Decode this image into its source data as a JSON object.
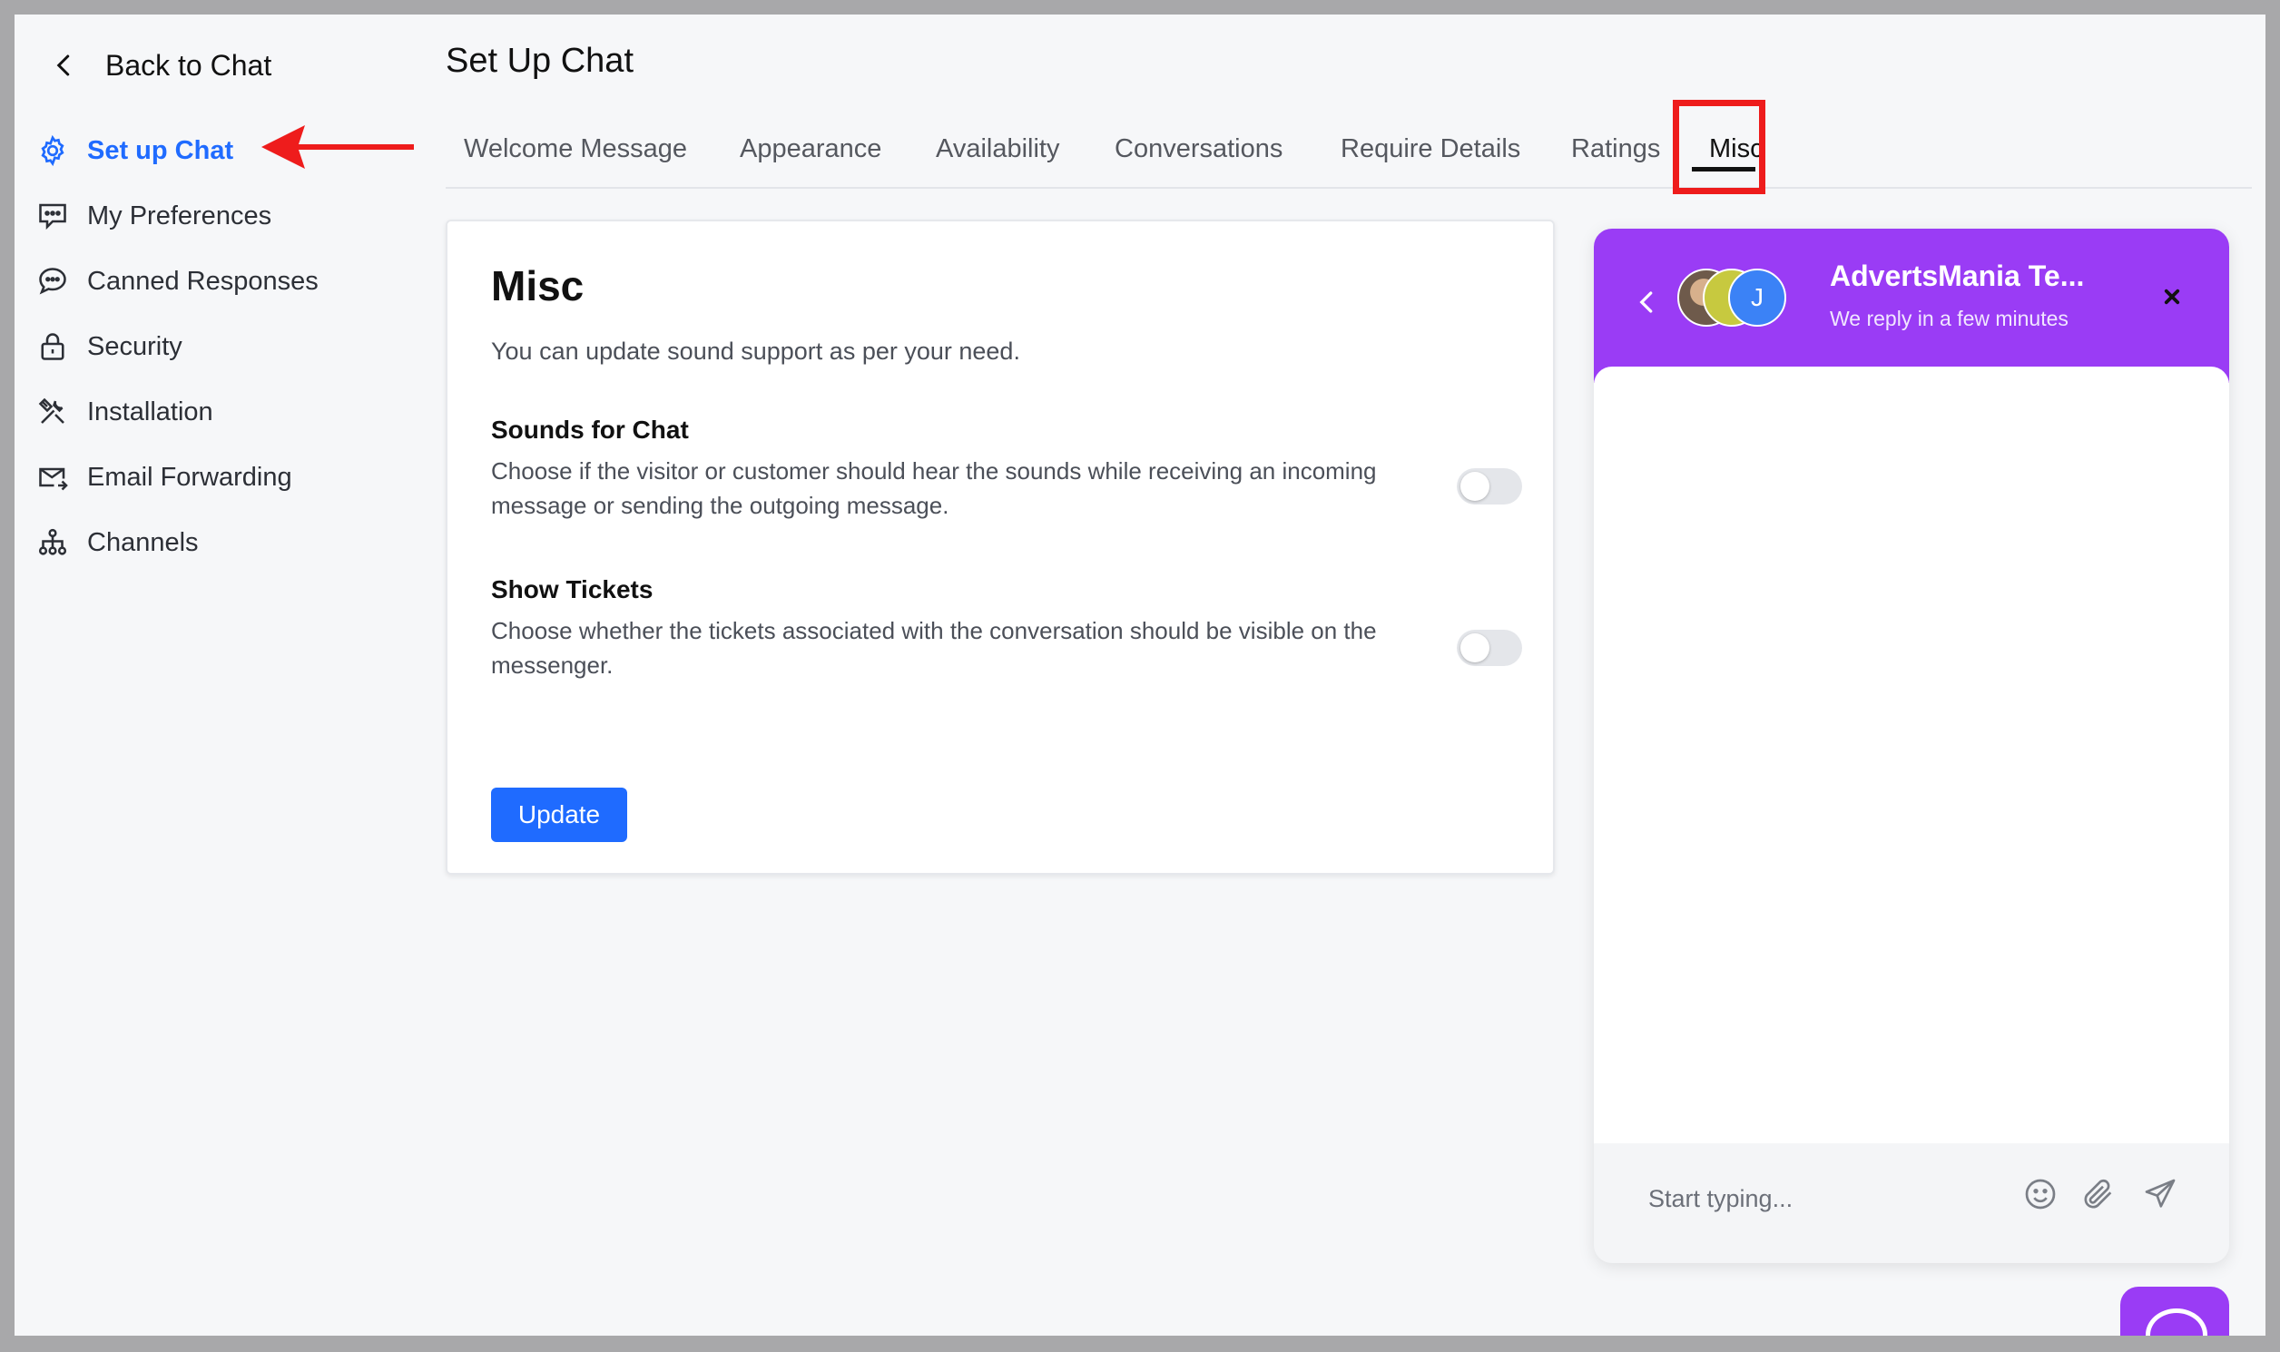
{
  "sidebar": {
    "back_label": "Back to Chat",
    "items": [
      {
        "label": "Set up Chat",
        "icon": "gear-icon"
      },
      {
        "label": "My Preferences",
        "icon": "preferences-icon"
      },
      {
        "label": "Canned Responses",
        "icon": "chat-bubble-icon"
      },
      {
        "label": "Security",
        "icon": "lock-icon"
      },
      {
        "label": "Installation",
        "icon": "tools-icon"
      },
      {
        "label": "Email Forwarding",
        "icon": "email-forward-icon"
      },
      {
        "label": "Channels",
        "icon": "channels-icon"
      }
    ],
    "active_index": 0
  },
  "header": {
    "title": "Set Up Chat",
    "tabs": [
      {
        "label": "Welcome Message"
      },
      {
        "label": "Appearance"
      },
      {
        "label": "Availability"
      },
      {
        "label": "Conversations"
      },
      {
        "label": "Require Details"
      },
      {
        "label": "Ratings"
      },
      {
        "label": "Misc"
      }
    ],
    "active_tab": "Misc"
  },
  "card": {
    "title": "Misc",
    "subtitle": "You can update sound support as per your need.",
    "settings": [
      {
        "title": "Sounds for Chat",
        "description": "Choose if the visitor or customer should hear the sounds while receiving an incoming message or sending the outgoing message.",
        "enabled": false
      },
      {
        "title": "Show Tickets",
        "description": "Choose whether the tickets associated with the conversation should be visible on the messenger.",
        "enabled": false
      }
    ],
    "update_label": "Update"
  },
  "messenger": {
    "team_name": "AdvertsMania Te...",
    "status": "We reply in a few minutes",
    "avatar_initial": "J",
    "input_placeholder": "Start typing...",
    "header_color": "#9a3cf5"
  },
  "colors": {
    "accent": "#1f6bff",
    "annotation": "#ee1c1c"
  }
}
